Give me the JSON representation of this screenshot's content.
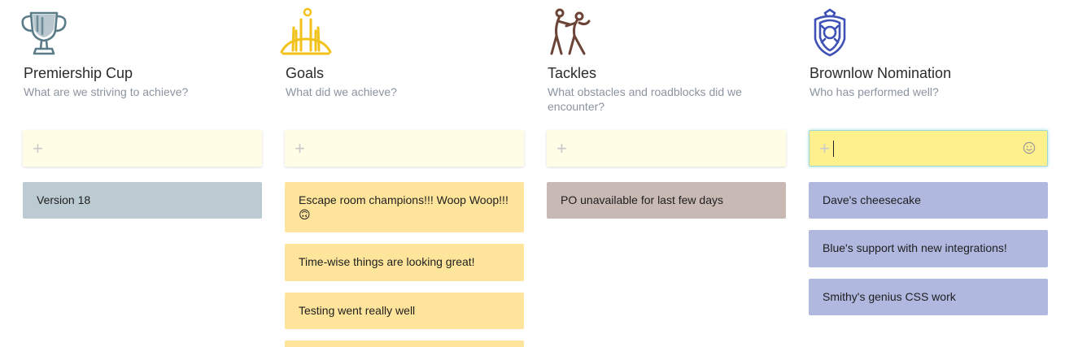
{
  "columns": [
    {
      "icon": "trophy-icon",
      "icon_color": "#5a7b88",
      "title": "Premiership Cup",
      "subtitle": "What are we striving to achieve?",
      "cards": [
        "Version 18"
      ],
      "card_color": "#bccbd2"
    },
    {
      "icon": "goal-posts-icon",
      "icon_color": "#f2c21a",
      "title": "Goals",
      "subtitle": "What did we achieve?",
      "cards": [
        "Escape room champions!!! Woop Woop!!! 🙃",
        "Time-wise things are looking great!",
        "Testing went really well"
      ],
      "card_color": "#ffe59c"
    },
    {
      "icon": "tackle-players-icon",
      "icon_color": "#6b4437",
      "title": "Tackles",
      "subtitle": "What obstacles and roadblocks did we encounter?",
      "cards": [
        "PO unavailable for last few days"
      ],
      "card_color": "#c9b9b4"
    },
    {
      "icon": "medal-crest-icon",
      "icon_color": "#3f51b5",
      "title": "Brownlow Nomination",
      "subtitle": "Who has performed well?",
      "cards": [
        "Dave's cheesecake",
        "Blue's support with new integrations!",
        "Smithy's genius CSS work"
      ],
      "card_color": "#b0b8e0"
    }
  ],
  "add_input_symbol": "+"
}
